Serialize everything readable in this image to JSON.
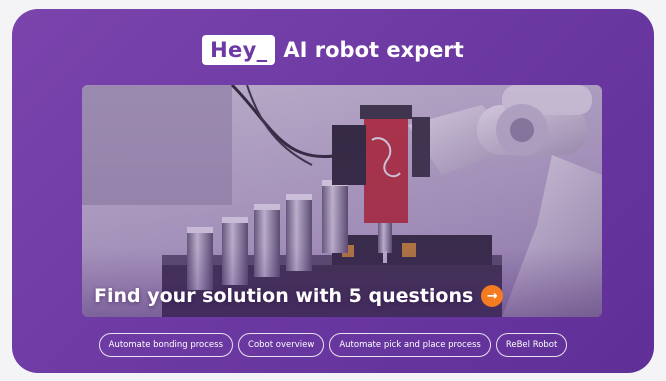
{
  "header": {
    "badge": "Hey_",
    "title": "AI robot expert"
  },
  "hero": {
    "cta_text": "Find your solution with 5 questions",
    "cta_icon": "arrow-right-icon",
    "cta_glyph": "→"
  },
  "chips": [
    {
      "label": "Automate bonding process"
    },
    {
      "label": "Cobot overview"
    },
    {
      "label": "Automate pick and place process"
    },
    {
      "label": "ReBel Robot"
    }
  ],
  "colors": {
    "card_background": "#6d3aa3",
    "accent_orange": "#f47b20",
    "badge_text": "#6d3aa3"
  }
}
